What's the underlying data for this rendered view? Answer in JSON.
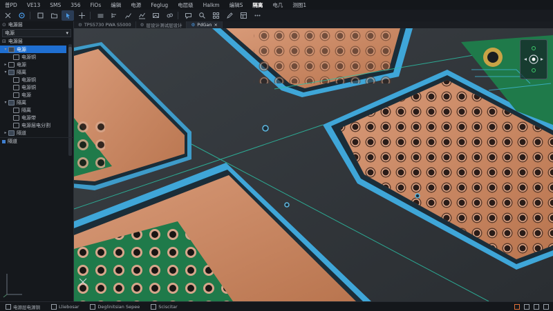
{
  "menu": {
    "items": [
      "普PD",
      "VE13",
      "SMS",
      "356",
      "FiOs",
      "编辑",
      "电源",
      "Feglug",
      "电层级",
      "Halkm",
      "编辑S",
      "隔离",
      "电几",
      "测图1"
    ],
    "active_index": 11
  },
  "toolbar": {
    "icons": [
      "close-icon",
      "target-icon",
      "square-icon",
      "folder-icon",
      "pointer-icon",
      "cross-icon",
      "layers-icon",
      "align-icon",
      "chart-icon",
      "route-icon",
      "image-icon",
      "link-icon",
      "comment-icon",
      "search-icon",
      "grid-icon",
      "pen-icon",
      "layout-icon",
      "dots-icon"
    ]
  },
  "sidebar": {
    "header": "电源层",
    "select_value": "电源",
    "tree_title": "电源层",
    "tree": [
      {
        "label": "电源",
        "level": 0,
        "folder": true,
        "selected": true,
        "caret": "▾"
      },
      {
        "label": "电源铜",
        "level": 1,
        "folder": false,
        "selected": false,
        "caret": ""
      },
      {
        "label": "电源",
        "level": 0,
        "folder": false,
        "selected": false,
        "caret": "▸"
      },
      {
        "label": "隔离",
        "level": 0,
        "folder": true,
        "selected": false,
        "caret": "▾"
      },
      {
        "label": "电源铜",
        "level": 1,
        "folder": false,
        "selected": false,
        "caret": ""
      },
      {
        "label": "电源铜",
        "level": 1,
        "folder": false,
        "selected": false,
        "caret": ""
      },
      {
        "label": "电源",
        "level": 1,
        "folder": false,
        "selected": false,
        "caret": ""
      },
      {
        "label": "隔离",
        "level": 0,
        "folder": true,
        "selected": false,
        "caret": "▾"
      },
      {
        "label": "隔离",
        "level": 1,
        "folder": false,
        "selected": false,
        "caret": ""
      },
      {
        "label": "电源带",
        "level": 1,
        "folder": false,
        "selected": false,
        "caret": ""
      },
      {
        "label": "电源层电分割",
        "level": 1,
        "folder": false,
        "selected": false,
        "caret": ""
      },
      {
        "label": "隔道",
        "level": 0,
        "folder": true,
        "selected": false,
        "caret": "▸"
      }
    ],
    "footer": "隔道"
  },
  "tabs": [
    {
      "label": "TPS5730 PWA S5000",
      "active": false
    },
    {
      "label": "层设计测试层设计",
      "active": false
    },
    {
      "label": "PdGan",
      "active": true
    }
  ],
  "statusbar": {
    "items": [
      "电源层电源铜",
      "Lliebosar",
      "Deglinitsian Sepee",
      "Sciscitar"
    ]
  },
  "colors": {
    "accent": "#1f6fd1",
    "copper": "#c98a66",
    "substrate": "#2e3236",
    "mask_blue": "#3fa6d8",
    "green_board": "#1f7a4a"
  }
}
